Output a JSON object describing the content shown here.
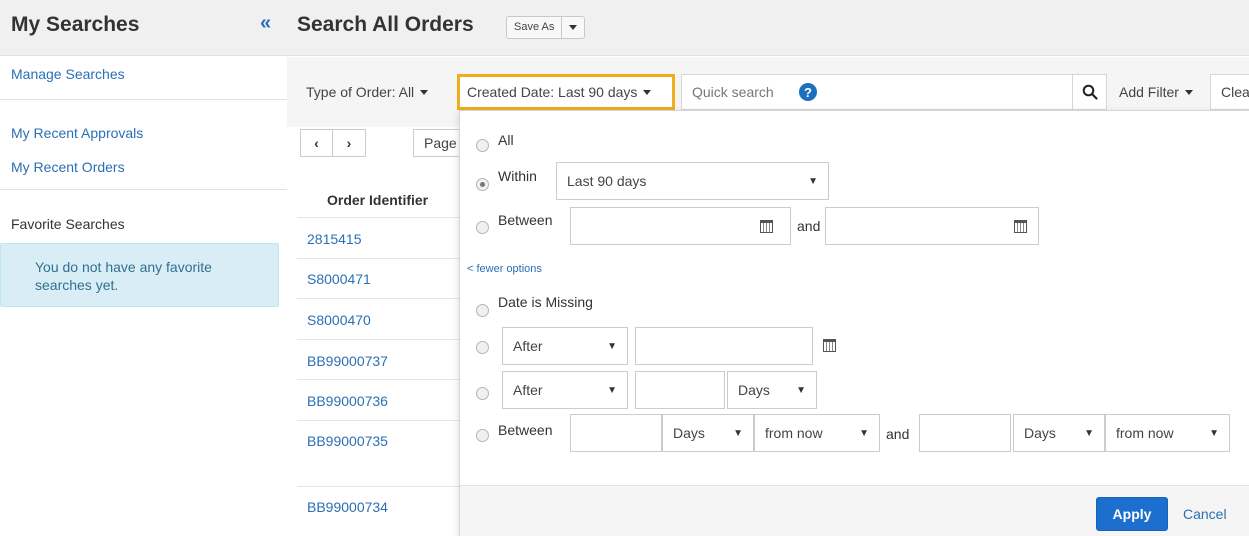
{
  "sidebar": {
    "title": "My Searches",
    "collapse_glyph": "«",
    "manage_link": "Manage Searches",
    "recent_approvals": "My Recent Approvals",
    "recent_orders": "My Recent Orders",
    "favorites_heading": "Favorite Searches",
    "favorites_empty": "You do not have any favorite searches yet."
  },
  "header": {
    "title": "Search All Orders",
    "save_as": "Save As"
  },
  "filters": {
    "type_of_order": "Type of Order: All",
    "created_date": "Created Date: Last 90 days",
    "quick_search_placeholder": "Quick search",
    "add_filter": "Add Filter",
    "clear": "Clear"
  },
  "grid": {
    "page_label": "Page",
    "column_header": "Order Identifier",
    "rows": [
      "2815415",
      "S8000471",
      "S8000470",
      "BB99000737",
      "BB99000736",
      "BB99000735",
      "BB99000734"
    ]
  },
  "date_panel": {
    "all_label": "All",
    "within_label": "Within",
    "within_value": "Last 90 days",
    "between_label": "Between",
    "and_label": "and",
    "fewer_options": "< fewer options",
    "date_missing_label": "Date is Missing",
    "after_label_1": "After",
    "after_label_2": "After",
    "days_label": "Days",
    "between2_label": "Between",
    "days_label_a": "Days",
    "from_now_a": "from now",
    "and_label_2": "and",
    "days_label_b": "Days",
    "from_now_b": "from now",
    "apply": "Apply",
    "cancel": "Cancel"
  }
}
